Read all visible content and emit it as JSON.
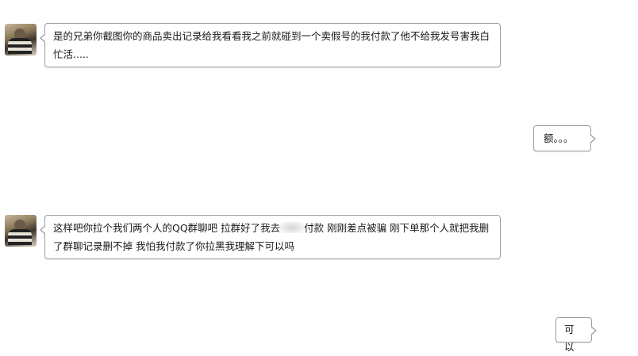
{
  "messages": [
    {
      "side": "left",
      "text": "是的兄弟你截图你的商品卖出记录给我看看我之前就碰到一个卖假号的我付款了他不给我发号害我白忙活....."
    },
    {
      "side": "right",
      "text": "额。。。"
    },
    {
      "side": "left",
      "text_before": "这样吧你拉个我们两个人的QQ群聊吧 拉群好了我去",
      "text_after": "付款 刚刚差点被骗 刚下单那个人就把我删了群聊记录删不掉 我怕我付款了你拉黑我理解下可以吗"
    },
    {
      "side": "right",
      "text": "可以"
    }
  ]
}
